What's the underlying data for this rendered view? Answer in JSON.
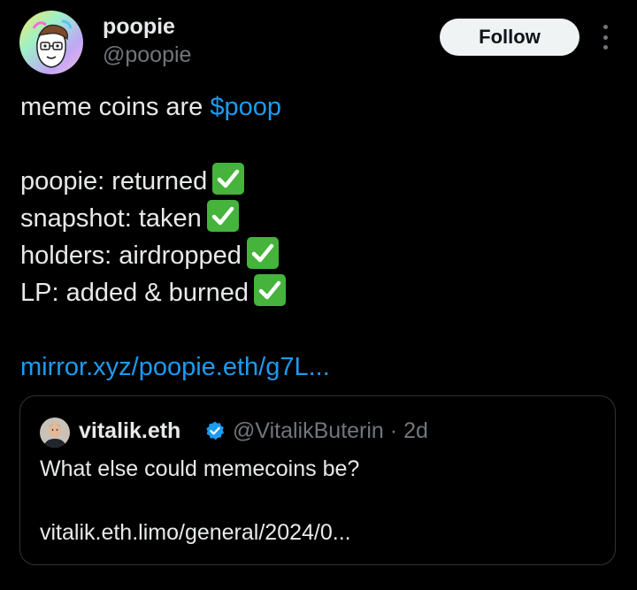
{
  "tweet": {
    "author": {
      "display_name": "poopie",
      "handle": "@poopie",
      "avatar_icon": "poopie-avatar"
    },
    "follow_label": "Follow",
    "more_icon": "more-dots-icon",
    "body": {
      "intro_text": "meme coins are ",
      "cashtag": "$poop",
      "checklist": [
        {
          "text": "poopie: returned",
          "icon": "check-mark-button-emoji"
        },
        {
          "text": "snapshot: taken",
          "icon": "check-mark-button-emoji"
        },
        {
          "text": "holders: airdropped",
          "icon": "check-mark-button-emoji"
        },
        {
          "text": "LP: added & burned",
          "icon": "check-mark-button-emoji"
        }
      ],
      "link": "mirror.xyz/poopie.eth/g7L..."
    }
  },
  "quote": {
    "author": {
      "display_name": "vitalik.eth",
      "handle": "@VitalikButerin",
      "separator": "·",
      "time": "2d",
      "verified_icon": "verified-badge-icon"
    },
    "text": "What else could memecoins be?",
    "link": "vitalik.eth.limo/general/2024/0..."
  },
  "colors": {
    "background": "#000000",
    "text": "#e7e9ea",
    "secondary": "#71767b",
    "link": "#1d9bf0",
    "check": "#45b33c",
    "border": "#2f3336"
  }
}
